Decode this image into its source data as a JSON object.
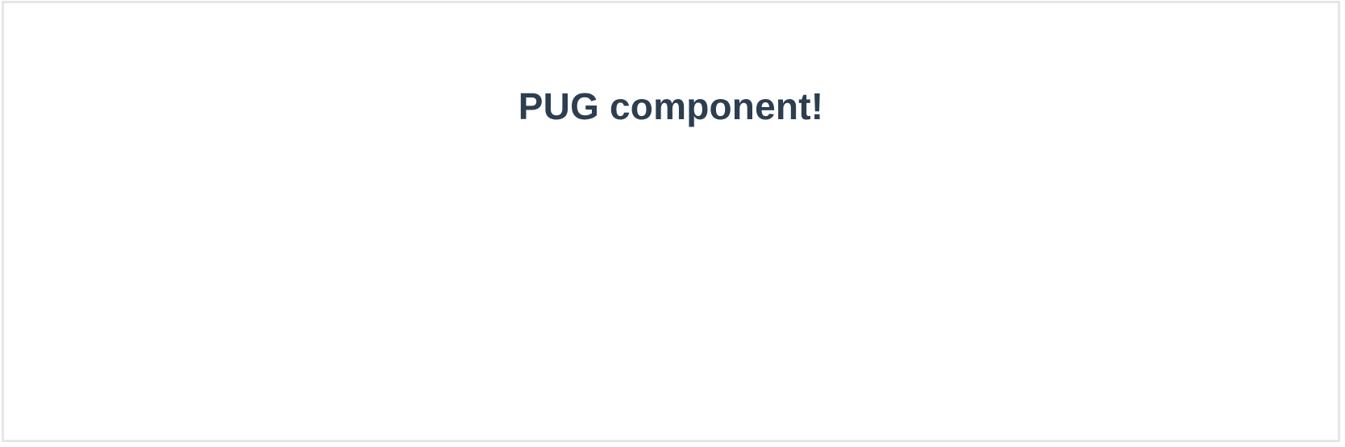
{
  "main": {
    "title": "PUG component!"
  },
  "colors": {
    "title_text": "#2c3e50",
    "frame_border": "#e6e6e6",
    "background": "#ffffff"
  }
}
